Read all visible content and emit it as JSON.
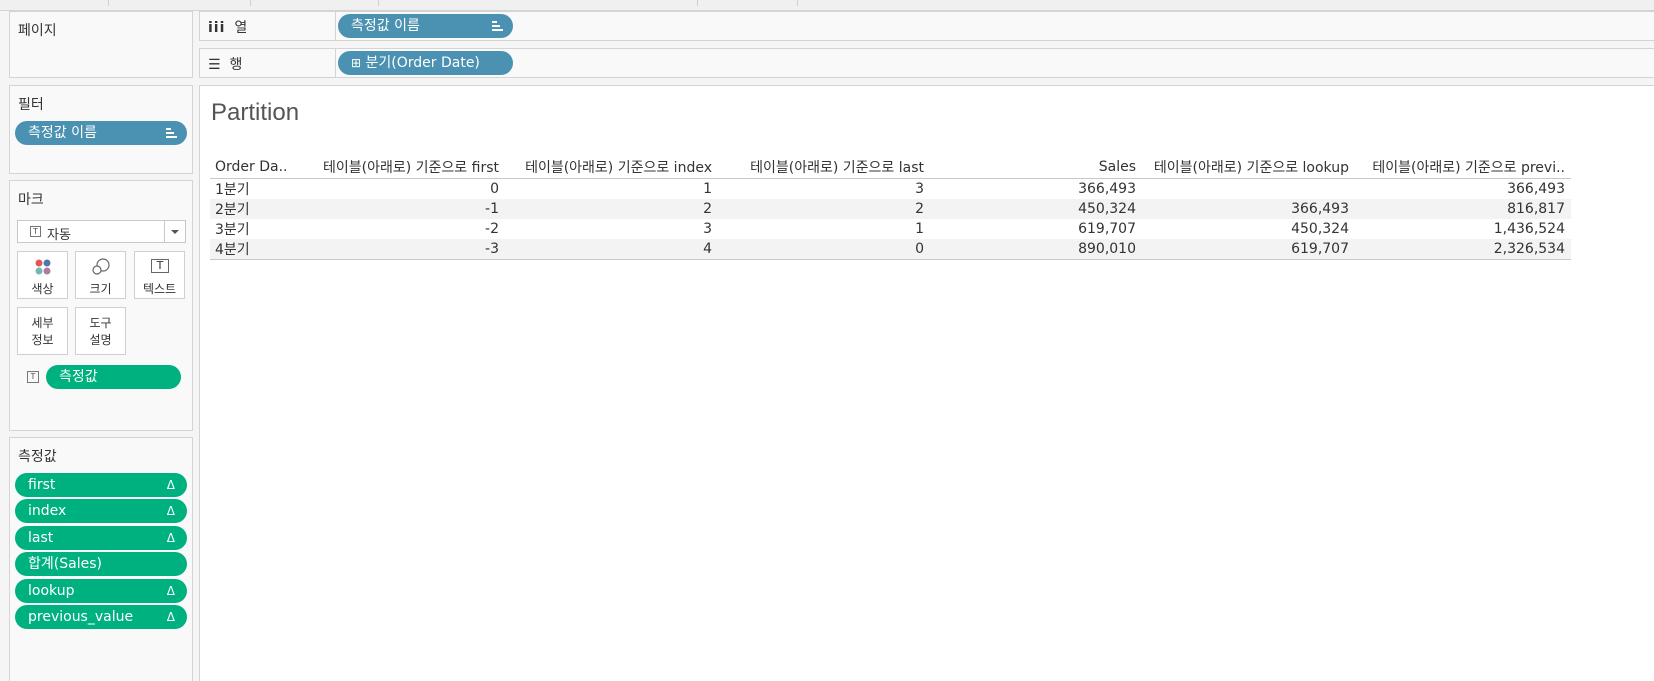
{
  "shelves": {
    "pages_title": "페이지",
    "columns": {
      "label": "열",
      "icon": "columns-icon",
      "pill": "측정값 이름"
    },
    "rows": {
      "label": "행",
      "icon": "rows-icon",
      "pill": "분기(Order Date)",
      "pill_prefix": "⊞"
    }
  },
  "filters": {
    "title": "필터",
    "pill": "측정값 이름"
  },
  "marks": {
    "title": "마크",
    "mark_type": "자동",
    "buttons": [
      {
        "label": "색상",
        "icon": "color-icon"
      },
      {
        "label": "크기",
        "icon": "size-icon"
      },
      {
        "label": "텍스트",
        "icon": "text-icon"
      },
      {
        "label_line1": "세부",
        "label_line2": "정보"
      },
      {
        "label_line1": "도구",
        "label_line2": "설명"
      }
    ],
    "text_pill": "측정값",
    "text_pill_icon_glyph": "T"
  },
  "measure_values": {
    "title": "측정값",
    "items": [
      {
        "label": "first",
        "delta": "Δ"
      },
      {
        "label": "index",
        "delta": "Δ"
      },
      {
        "label": "last",
        "delta": "Δ"
      },
      {
        "label": "합계(Sales)",
        "delta": ""
      },
      {
        "label": "lookup",
        "delta": "Δ"
      },
      {
        "label": "previous_value",
        "delta": "Δ"
      }
    ]
  },
  "worksheet": {
    "title": "Partition",
    "columns": [
      "Order Da..",
      "테이블(아래로) 기준으로 first",
      "테이블(아래로) 기준으로 index",
      "테이블(아래로) 기준으로 last",
      "Sales",
      "테이블(아래로) 기준으로 lookup",
      "테이블(아래로) 기준으로 previ.."
    ],
    "rows": [
      {
        "quarter": "1분기",
        "first": "0",
        "index": "1",
        "last": "3",
        "sales": "366,493",
        "lookup": "",
        "previous": "366,493"
      },
      {
        "quarter": "2분기",
        "first": "-1",
        "index": "2",
        "last": "2",
        "sales": "450,324",
        "lookup": "366,493",
        "previous": "816,817"
      },
      {
        "quarter": "3분기",
        "first": "-2",
        "index": "3",
        "last": "1",
        "sales": "619,707",
        "lookup": "450,324",
        "previous": "1,436,524"
      },
      {
        "quarter": "4분기",
        "first": "-3",
        "index": "4",
        "last": "0",
        "sales": "890,010",
        "lookup": "619,707",
        "previous": "2,326,534"
      }
    ]
  },
  "colors": {
    "dimension_pill": "#4a91b2",
    "measure_pill": "#00b180"
  }
}
